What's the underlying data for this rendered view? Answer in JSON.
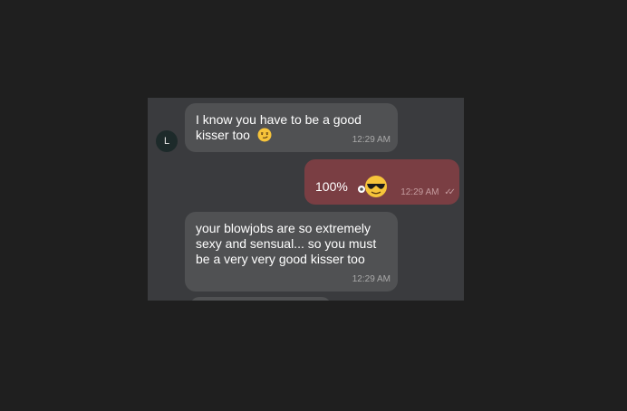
{
  "chat": {
    "contact_initial": "L",
    "messages": [
      {
        "direction": "incoming",
        "text": "I know you have to be a good kisser too",
        "emoji": "smirking-face-icon",
        "time": "12:29 AM"
      },
      {
        "direction": "outgoing",
        "text": "100%",
        "emoji": "sunglasses-face-icon",
        "time": "12:29 AM",
        "read_receipt": "double-check-icon"
      },
      {
        "direction": "incoming",
        "text": "your blowjobs are so extremely sexy and sensual... so you must be a very very good kisser too",
        "time": "12:29 AM"
      }
    ]
  },
  "colors": {
    "page_background": "#1f1f1f",
    "chat_background": "#3a3b3e",
    "incoming_bubble": "#505153",
    "outgoing_bubble": "#7a3e43"
  }
}
